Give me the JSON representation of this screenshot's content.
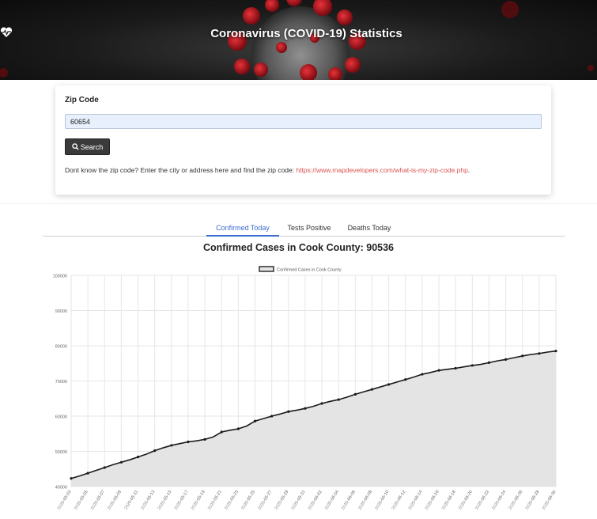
{
  "header": {
    "title": "Coronavirus (COVID-19) Statistics",
    "icon": "heartbeat-icon"
  },
  "search_card": {
    "label": "Zip Code",
    "zip_value": "60654",
    "zip_placeholder": "",
    "search_label": "Search",
    "search_icon": "search-icon",
    "help_prefix": "Dont know the zip code? Enter the city or address here and find the zip code: ",
    "help_link": "https://www.mapdevelopers.com/what-is-my-zip-code.php",
    "help_suffix": "."
  },
  "tabs": [
    {
      "label": "Confirmed Today",
      "active": true
    },
    {
      "label": "Tests Positive",
      "active": false
    },
    {
      "label": "Deaths Today",
      "active": false
    }
  ],
  "colors": {
    "accent": "#3b6ccf",
    "link": "#d9534f",
    "line": "#1a1a1a",
    "fill": "#e4e4e4"
  },
  "chart_data": {
    "type": "area",
    "title": "Confirmed Cases in Cook County: 90536",
    "legend": [
      "Confirmed Cases in Cook County"
    ],
    "legend_position": "top-center",
    "grid": true,
    "ylim": [
      40000,
      100000
    ],
    "y_ticks": [
      40000,
      50000,
      60000,
      70000,
      80000,
      90000,
      100000
    ],
    "x": [
      "2020-05-03",
      "2020-05-04",
      "2020-05-05",
      "2020-05-06",
      "2020-05-07",
      "2020-05-08",
      "2020-05-09",
      "2020-05-10",
      "2020-05-11",
      "2020-05-12",
      "2020-05-13",
      "2020-05-14",
      "2020-05-15",
      "2020-05-16",
      "2020-05-17",
      "2020-05-18",
      "2020-05-19",
      "2020-05-20",
      "2020-05-21",
      "2020-05-22",
      "2020-05-23",
      "2020-05-24",
      "2020-05-25",
      "2020-05-26",
      "2020-05-27",
      "2020-05-28",
      "2020-05-29",
      "2020-05-30",
      "2020-05-31",
      "2020-06-01",
      "2020-06-02",
      "2020-06-03",
      "2020-06-04",
      "2020-06-05",
      "2020-06-06",
      "2020-06-07",
      "2020-06-08",
      "2020-06-09",
      "2020-06-10",
      "2020-06-11",
      "2020-06-12",
      "2020-06-13",
      "2020-06-14",
      "2020-06-15",
      "2020-06-16",
      "2020-06-17",
      "2020-06-18",
      "2020-06-19",
      "2020-06-20",
      "2020-06-21",
      "2020-06-22",
      "2020-06-23",
      "2020-06-24",
      "2020-06-25",
      "2020-06-26",
      "2020-06-27",
      "2020-06-28",
      "2020-06-29",
      "2020-06-30"
    ],
    "x_tick_labels": [
      "2020-05-03",
      "2020-05-05",
      "2020-05-07",
      "2020-05-09",
      "2020-05-11",
      "2020-05-13",
      "2020-05-15",
      "2020-05-17",
      "2020-05-19",
      "2020-05-21",
      "2020-05-23",
      "2020-05-25",
      "2020-05-27",
      "2020-05-29",
      "2020-05-31",
      "2020-06-02",
      "2020-06-04",
      "2020-06-06",
      "2020-06-08",
      "2020-06-10",
      "2020-06-12",
      "2020-06-14",
      "2020-06-16",
      "2020-06-18",
      "2020-06-20",
      "2020-06-22",
      "2020-06-24",
      "2020-06-26",
      "2020-06-28",
      "2020-06-30"
    ],
    "series": [
      {
        "name": "Confirmed Cases in Cook County",
        "values": [
          42300,
          43000,
          43800,
          44600,
          45400,
          46200,
          46900,
          47600,
          48400,
          49200,
          50200,
          51000,
          51700,
          52200,
          52700,
          53000,
          53400,
          54100,
          55500,
          56000,
          56400,
          57200,
          58600,
          59300,
          60000,
          60600,
          61300,
          61700,
          62200,
          62800,
          63600,
          64200,
          64700,
          65400,
          66200,
          66900,
          67600,
          68300,
          69000,
          69700,
          70400,
          71100,
          71900,
          72400,
          73000,
          73300,
          73600,
          74000,
          74400,
          74700,
          75200,
          75700,
          76100,
          76600,
          77100,
          77500,
          77800,
          78200,
          78500
        ]
      }
    ]
  }
}
